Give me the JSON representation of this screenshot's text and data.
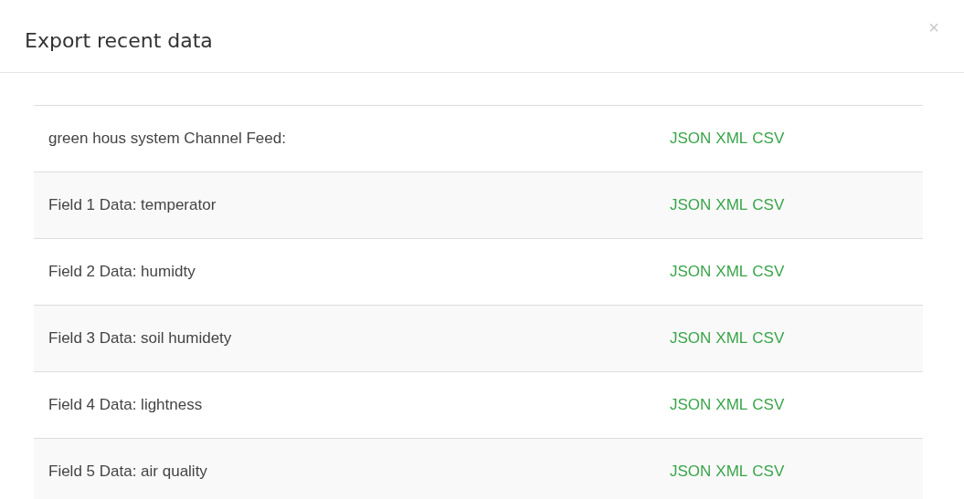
{
  "dialog": {
    "title": "Export recent data",
    "close": "×"
  },
  "rows": [
    {
      "label": "green hous system Channel Feed:",
      "links": [
        "JSON",
        "XML",
        "CSV"
      ]
    },
    {
      "label": "Field 1 Data: temperator",
      "links": [
        "JSON",
        "XML",
        "CSV"
      ]
    },
    {
      "label": "Field 2 Data: humidty",
      "links": [
        "JSON",
        "XML",
        "CSV"
      ]
    },
    {
      "label": "Field 3 Data: soil humidety",
      "links": [
        "JSON",
        "XML",
        "CSV"
      ]
    },
    {
      "label": "Field 4 Data: lightness",
      "links": [
        "JSON",
        "XML",
        "CSV"
      ]
    },
    {
      "label": "Field 5 Data: air quality",
      "links": [
        "JSON",
        "XML",
        "CSV"
      ]
    }
  ]
}
